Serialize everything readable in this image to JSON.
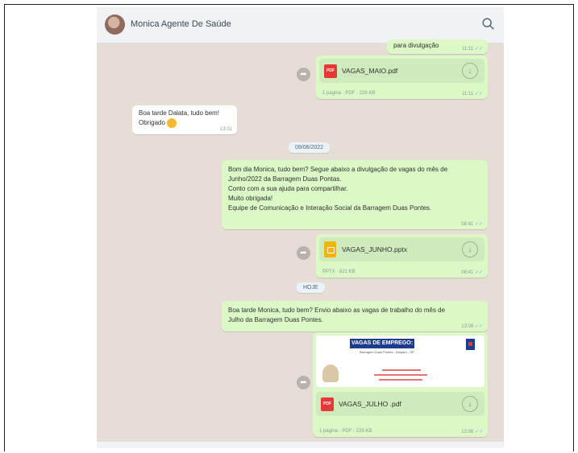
{
  "header": {
    "contact_name": "Monica Agente De Saúde",
    "avatar_icon": "contact-avatar",
    "search_icon": "search-icon"
  },
  "messages": {
    "m1_text_tail": "para divulgação",
    "m1_time": "11:11",
    "m2_filename": "VAGAS_MAIO.pdf",
    "m2_meta": "1 página · PDF · 229 KB",
    "m2_time": "11:11",
    "m3_text": "Boa tarde Dalata, tudo bem!\nObrigado",
    "m3_time": "13:01",
    "date1": "09/06/2022",
    "m4_text": "Bom dia Monica, tudo bem? Segue abaixo a divulgação de vagas do mês de\nJunho/2022 da Barragem Duas Pontas.\nConto com a sua ajuda para compartilhar.\nMuito obrigada!\nEquipe de Comunicação e Interação Social da Barragem Duas Pontes.",
    "m4_time": "08:41",
    "m5_filename": "VAGAS_JUNHO.pptx",
    "m5_meta": "PPTX · 821 KB",
    "m5_time": "08:41",
    "date2": "HOJE",
    "m6_text": "Boa tarde Monica, tudo bem? Envio abaixo as vagas de trabalho do mês de\nJulho da Barragem Duas Pontes.",
    "m6_time": "13:08",
    "m7_preview_title": "VAGAS DE EMPREGO:",
    "m7_preview_sub": "Barragem Duas Pontes - Amparo - SP",
    "m7_filename": "VAGAS_JULHO .pdf",
    "m7_meta": "1 página · PDF · 229 KB",
    "m7_time": "13:08",
    "pdf_badge": "PDF",
    "download_glyph": "↓",
    "forward_glyph": "➦",
    "tick_glyph": "✓✓"
  },
  "colors": {
    "chat_bg": "#e6ddd4",
    "outgoing_bubble": "#dcf8c6",
    "incoming_bubble": "#ffffff",
    "read_tick": "#4fc3f7"
  }
}
